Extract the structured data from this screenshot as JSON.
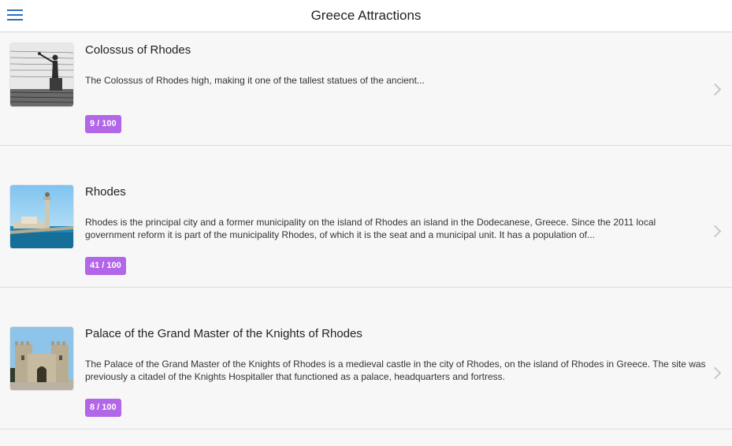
{
  "header": {
    "title": "Greece Attractions",
    "menu_icon": "hamburger-menu-icon"
  },
  "items": [
    {
      "title": "Colossus of Rhodes",
      "description": "The Colossus of Rhodes high, making it one of the tallest statues of the ancient...",
      "score": "9 / 100",
      "thumb": "colossus-engraving-image"
    },
    {
      "title": "Rhodes",
      "description": "Rhodes is the principal city and a former municipality on the island of Rhodes an island in the Dodecanese, Greece. Since the 2011 local government reform it is part of the municipality Rhodes, of which it is the seat and a municipal unit. It has a population of...",
      "score": "41 / 100",
      "thumb": "rhodes-harbor-image"
    },
    {
      "title": "Palace of the Grand Master of the Knights of Rhodes",
      "description": "The Palace of the Grand Master of the Knights of Rhodes is a medieval castle in the city of Rhodes, on the island of Rhodes in Greece. The site was previously a citadel of the Knights Hospitaller that functioned as a palace, headquarters and fortress.",
      "score": "8 / 100",
      "thumb": "palace-castle-image"
    }
  ],
  "colors": {
    "badge": "#b266e8",
    "menu_icon": "#2f6fbf",
    "chevron": "#c7c7cc"
  }
}
